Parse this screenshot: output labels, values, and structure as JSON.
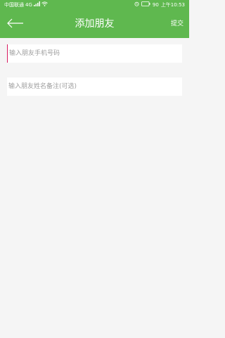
{
  "status_bar": {
    "carrier": "中国联通",
    "network": "4G",
    "battery": "90",
    "time": "上午10:53"
  },
  "header": {
    "title": "添加朋友",
    "submit_label": "提交",
    "background_color": "#5fb84f"
  },
  "form": {
    "phone_placeholder": "输入朋友手机号码",
    "phone_value": "",
    "name_placeholder": "输入朋友姓名备注(可选)",
    "name_value": ""
  },
  "colors": {
    "accent": "#5fb84f",
    "cursor": "#d81b60",
    "page_background": "#f5f5f5"
  }
}
